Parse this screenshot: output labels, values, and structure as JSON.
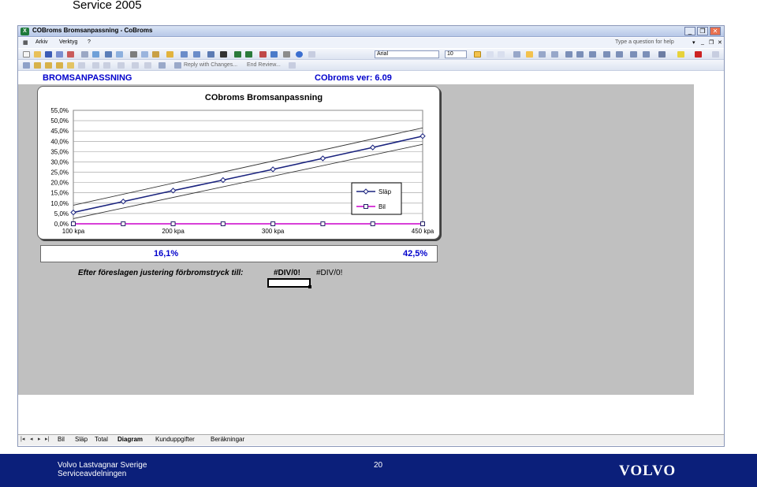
{
  "slide": {
    "title": "Service 2005"
  },
  "window": {
    "title": "COBroms Bromsanpassning - CoBroms",
    "controls": [
      "_",
      "❐",
      "✕"
    ]
  },
  "menubar": {
    "items": [
      "Arkiv",
      "Verktyg",
      "?"
    ],
    "help_placeholder": "Type a question for help"
  },
  "toolbar": {
    "font_name": "Arial",
    "font_size": "10",
    "reply_label": "Reply with Changes...",
    "end_review_label": "End Review..."
  },
  "sheet": {
    "header_left": "BROMSANPASSNING",
    "header_right": "CObroms ver: 6.09",
    "pct_left": "16,1%",
    "pct_right": "42,5%",
    "note": "Efter föreslagen justering förbromstryck till:",
    "div_value": "#DIV/0!",
    "div_value2": "#DIV/0!"
  },
  "chart_data": {
    "type": "line",
    "title": "CObroms Bromsanpassning",
    "x": [
      100,
      150,
      200,
      250,
      300,
      350,
      400,
      450
    ],
    "x_tick_labels": {
      "100": "100 kpa",
      "200": "200 kpa",
      "300": "300 kpa",
      "450": "450 kpa"
    },
    "y_ticks": [
      0,
      5,
      10,
      15,
      20,
      25,
      30,
      35,
      40,
      45,
      50,
      55
    ],
    "y_tick_labels": [
      "0,0%",
      "5,0%",
      "10,0%",
      "15,0%",
      "20,0%",
      "25,0%",
      "30,0%",
      "35,0%",
      "40,0%",
      "45,0%",
      "50,0%",
      "55,0%"
    ],
    "ylim": [
      0,
      55
    ],
    "xlim": [
      100,
      450
    ],
    "series": [
      {
        "name": "Släp",
        "values": [
          5.5,
          10.8,
          16.1,
          21.2,
          26.4,
          31.7,
          37.0,
          42.5
        ],
        "color": "#1a237e",
        "marker": "diamond"
      },
      {
        "name": "Bil",
        "values": [
          0,
          0,
          0,
          0,
          0,
          0,
          0,
          0
        ],
        "color": "#cc00cc",
        "marker": "square"
      }
    ],
    "band_lines": [
      {
        "values": [
          9.0,
          46.5
        ],
        "color": "#333333"
      },
      {
        "values": [
          2.5,
          38.5
        ],
        "color": "#333333"
      }
    ],
    "grid": true,
    "legend_position": "right"
  },
  "sheet_tabs": [
    "Bil",
    "Släp",
    "Total",
    "Diagram",
    "Kunduppgifter",
    "Beräkningar"
  ],
  "active_tab": "Diagram",
  "footer": {
    "org_line1": "Volvo Lastvagnar Sverige",
    "org_line2": "Serviceavdelningen",
    "page_number": "20",
    "logo_text": "VOLVO"
  },
  "colors": {
    "footer_bg": "#0b1f7a",
    "header_text": "#0000cc",
    "sheet_bg": "#c0c0c0"
  }
}
